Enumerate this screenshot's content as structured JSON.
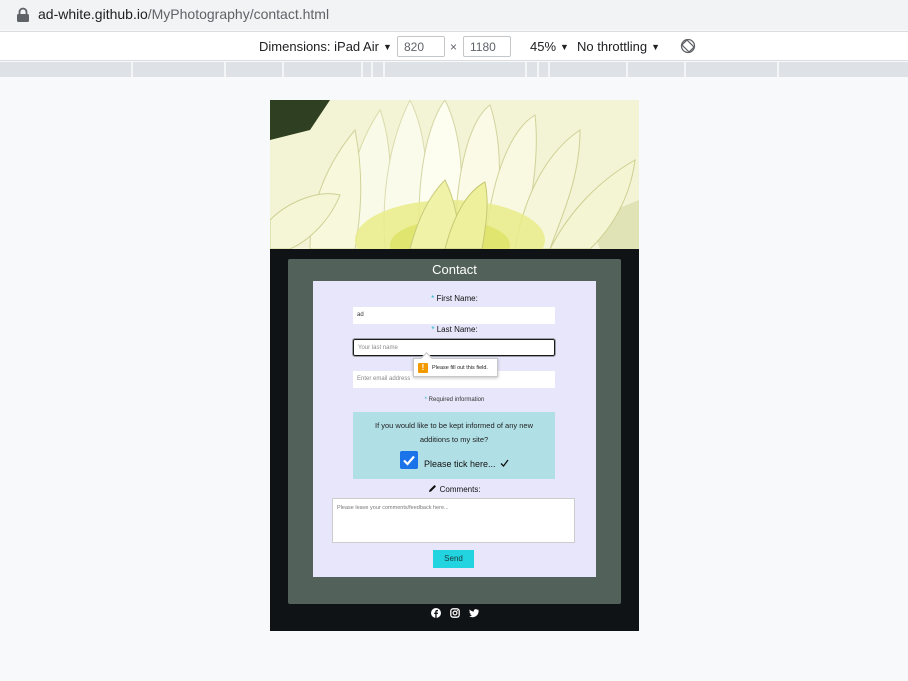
{
  "browser": {
    "url_host": "ad-white.github.io",
    "url_path": "/MyPhotography/contact.html"
  },
  "device_toolbar": {
    "dimensions_label": "Dimensions: iPad Air",
    "width": "820",
    "times": "×",
    "height": "1180",
    "zoom": "45%",
    "throttling": "No throttling"
  },
  "page": {
    "title": "Contact",
    "first_name_label": "First Name:",
    "first_name_value": "ad",
    "last_name_label": "Last Name:",
    "last_name_placeholder": "Your last name",
    "validation_message": "Please fill out this field.",
    "email_placeholder": "Enter email address",
    "required_note": "Required information",
    "required_star": "*",
    "opt_in_text": "If you would like to be kept informed of any new additions to my site?",
    "checkbox_label": "Please tick here...",
    "checkbox_checked": true,
    "comments_label": "Comments:",
    "comments_placeholder": "Please leave your comments/feedback here...",
    "send_label": "Send"
  },
  "icons": [
    "lock-icon",
    "rotate-icon",
    "warning-icon",
    "checkmark-icon",
    "pencil-icon",
    "facebook-icon",
    "instagram-icon",
    "twitter-icon"
  ],
  "colors": {
    "panel": "#526159",
    "form_bg": "#e8e6fb",
    "opt_box": "#b0e0e6",
    "send_button": "#21d4e0",
    "accent_star": "#1fb8c6",
    "checkbox": "#1a73e8"
  }
}
